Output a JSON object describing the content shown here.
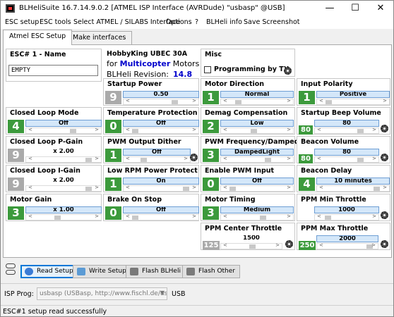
{
  "window": {
    "title": "BLHeliSuite 16.7.14.9.0.2  [ATMEL ISP Interface (AVRDude) \"usbasp\" @USB]",
    "minimize": "—",
    "maximize": "☐",
    "close": "✕"
  },
  "menu": [
    "ESC setup",
    "ESC tools",
    "Select ATMEL / SILABS Interface",
    "Options",
    "?",
    "BLHeli info",
    "Save Screenshot"
  ],
  "tabs": [
    "Atmel ESC Setup",
    "Make interfaces"
  ],
  "esc": {
    "label": "ESC# 1 - Name",
    "name": "EMPTY"
  },
  "info": {
    "line1": "HobbyKing UBEC 30A",
    "for": "for",
    "type": "Multicopter",
    "motors": "Motors",
    "rev_label": "BLHeli Revision:",
    "rev": "14.8"
  },
  "misc": {
    "label": "Misc",
    "programming_by_tx": "Programming by TX"
  },
  "params": {
    "startup_power": {
      "label": "Startup Power",
      "num": "9",
      "value": "0.50"
    },
    "motor_direction": {
      "label": "Motor Direction",
      "num": "1",
      "value": "Normal"
    },
    "input_polarity": {
      "label": "Input Polarity",
      "num": "1",
      "value": "Positive"
    },
    "closed_loop_mode": {
      "label": "Closed Loop Mode",
      "num": "4",
      "value": "Off"
    },
    "temperature_protection": {
      "label": "Temperature Protection",
      "num": "0",
      "value": "Off"
    },
    "demag_compensation": {
      "label": "Demag Compensation",
      "num": "2",
      "value": "Low"
    },
    "startup_beep_volume": {
      "label": "Startup Beep Volume",
      "num": "80",
      "value": "80"
    },
    "closed_loop_pgain": {
      "label": "Closed Loop P-Gain",
      "num": "9",
      "value": "x 2.00"
    },
    "pwm_output_dither": {
      "label": "PWM Output Dither",
      "num": "1",
      "value": "Off"
    },
    "pwm_frequency": {
      "label": "PWM Frequency/Damped",
      "num": "3",
      "value": "DampedLight"
    },
    "beacon_volume": {
      "label": "Beacon Volume",
      "num": "80",
      "value": "80"
    },
    "closed_loop_igain": {
      "label": "Closed Loop I-Gain",
      "num": "9",
      "value": "x 2.00"
    },
    "low_rpm_power_protect": {
      "label": "Low RPM Power Protect",
      "num": "1",
      "value": "On"
    },
    "enable_pwm_input": {
      "label": "Enable PWM Input",
      "num": "0",
      "value": "Off"
    },
    "beacon_delay": {
      "label": "Beacon Delay",
      "num": "4",
      "value": "10 minutes"
    },
    "motor_gain": {
      "label": "Motor Gain",
      "num": "3",
      "value": "x 1.00"
    },
    "brake_on_stop": {
      "label": "Brake On Stop",
      "num": "0",
      "value": "Off"
    },
    "motor_timing": {
      "label": "Motor Timing",
      "num": "3",
      "value": "Medium"
    },
    "ppm_min_throttle": {
      "label": "PPM Min Throttle",
      "num": "",
      "value": "1000"
    },
    "ppm_center_throttle": {
      "label": "PPM Center Throttle",
      "num": "125",
      "value": "1500"
    },
    "ppm_max_throttle": {
      "label": "PPM Max Throttle",
      "num": "250",
      "value": "2000"
    }
  },
  "buttons": {
    "read": "Read Setup",
    "write": "Write Setup",
    "flash_blheli": "Flash BLHeli",
    "flash_other": "Flash Other"
  },
  "isp": {
    "label": "ISP Prog:",
    "value": "usbasp (USBasp, http://www.fischl.de/usbasp/)",
    "port": "USB"
  },
  "status": "ESC#1 setup read successfully",
  "colors": {
    "accent": "#0078d7",
    "num_green": "#3c9a3c",
    "num_gray": "#aaaaaa",
    "value_bg": "#d4e7f9",
    "blue_text": "#0000cc"
  }
}
